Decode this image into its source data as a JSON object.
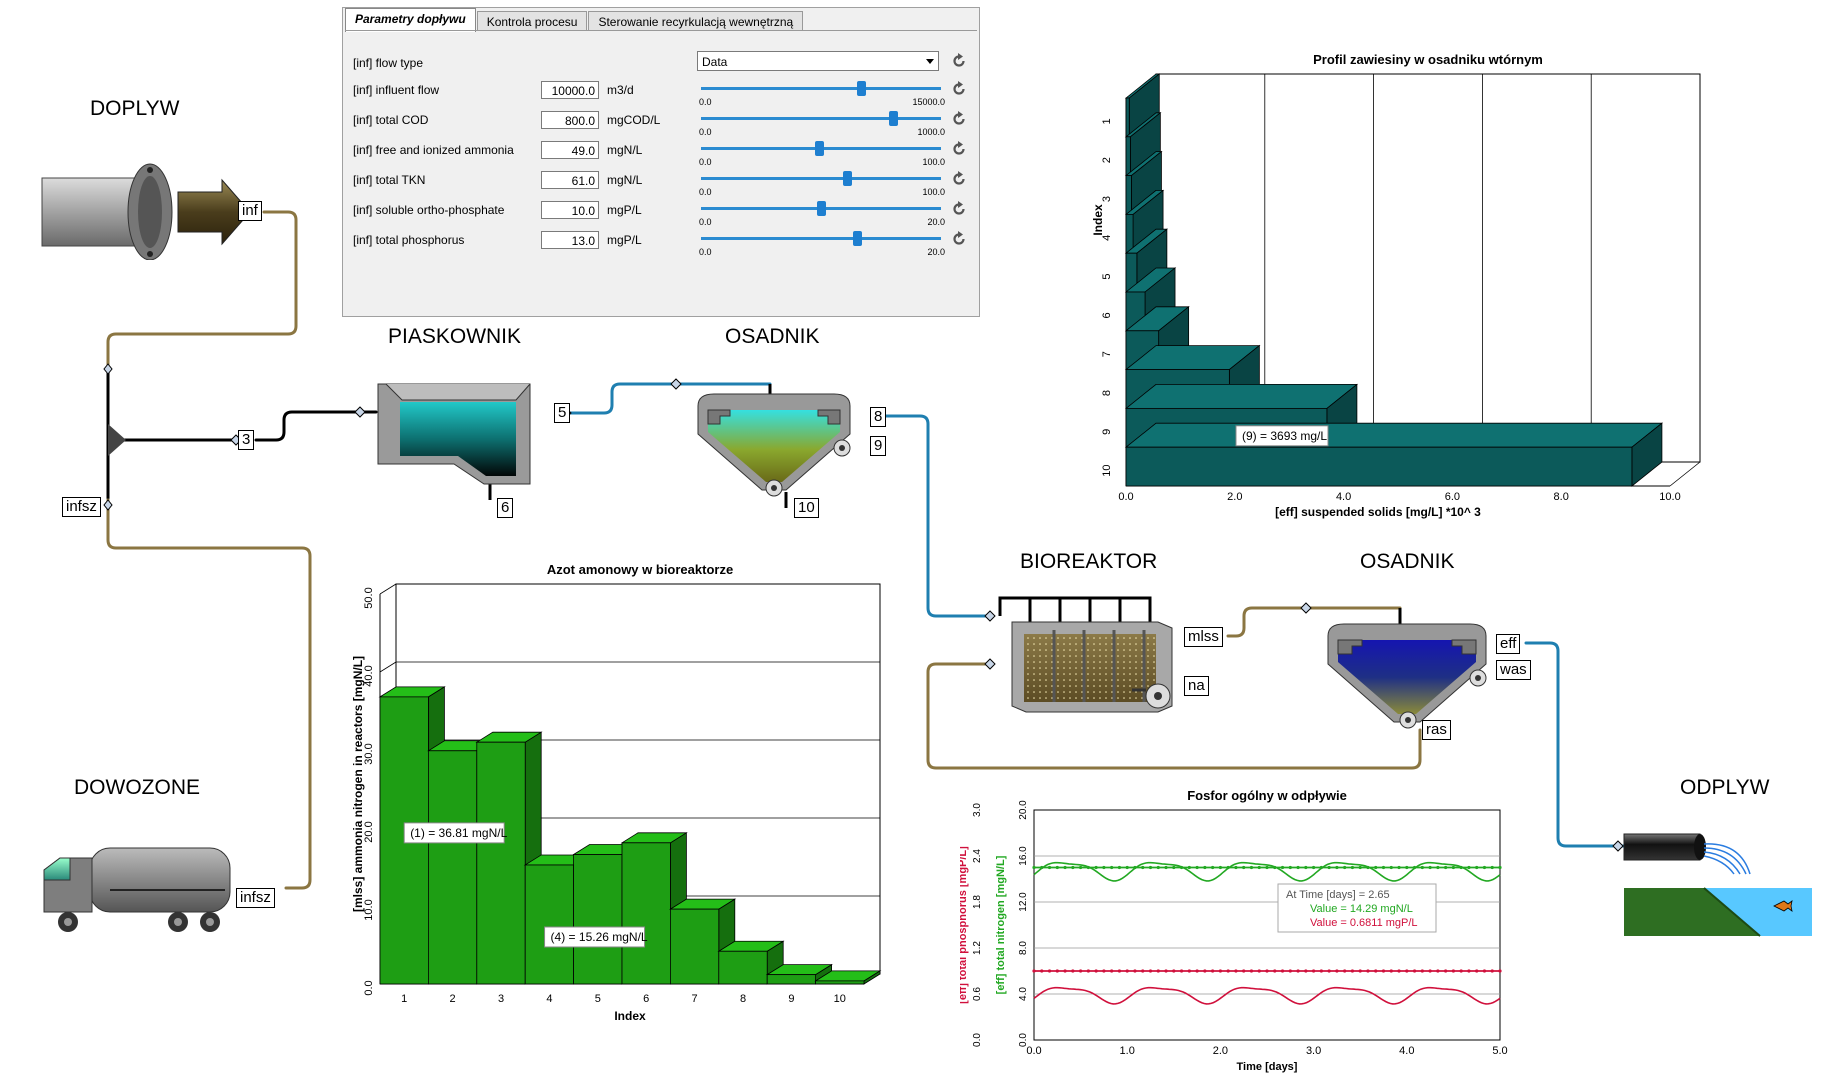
{
  "units": {
    "doplyw": "DOPLYW",
    "piaskownik": "PIASKOWNIK",
    "osadnik1": "OSADNIK",
    "bioreaktor": "BIOREAKTOR",
    "osadnik2": "OSADNIK",
    "dowozone": "DOWOZONE",
    "odplyw": "ODPLYW"
  },
  "ports": {
    "inf": "inf",
    "infsz_split": "infsz",
    "infsz_truck": "infsz",
    "p3": "3",
    "p5": "5",
    "p6": "6",
    "p8": "8",
    "p9": "9",
    "p10": "10",
    "mlss": "mlss",
    "na": "na",
    "eff": "eff",
    "was": "was",
    "ras": "ras"
  },
  "panel": {
    "tabs": [
      "Parametry dopływu",
      "Kontrola procesu",
      "Sterowanie recyrkulacją wewnętrzną"
    ],
    "flow_type_label": "[inf] flow type",
    "flow_type_value": "Data",
    "rows": [
      {
        "label": "[inf] influent flow",
        "value": "10000.0",
        "unit": "m3/d",
        "min": "0.0",
        "max": "15000.0",
        "level": 0.667
      },
      {
        "label": "[inf] total COD",
        "value": "800.0",
        "unit": "mgCOD/L",
        "min": "0.0",
        "max": "1000.0",
        "level": 0.8
      },
      {
        "label": "[inf] free and ionized ammonia",
        "value": "49.0",
        "unit": "mgN/L",
        "min": "0.0",
        "max": "100.0",
        "level": 0.49
      },
      {
        "label": "[inf] total TKN",
        "value": "61.0",
        "unit": "mgN/L",
        "min": "0.0",
        "max": "100.0",
        "level": 0.61
      },
      {
        "label": "[inf] soluble ortho-phosphate",
        "value": "10.0",
        "unit": "mgP/L",
        "min": "0.0",
        "max": "20.0",
        "level": 0.5
      },
      {
        "label": "[inf] total phosphorus",
        "value": "13.0",
        "unit": "mgP/L",
        "min": "0.0",
        "max": "20.0",
        "level": 0.65
      }
    ]
  },
  "chart_data": [
    {
      "type": "bar",
      "title": "Azot amonowy w bioreaktorze",
      "xlabel": "Index",
      "ylabel": "[mlss] ammonia nitrogen in reactors [mgN/L]",
      "categories": [
        "1",
        "2",
        "3",
        "4",
        "5",
        "6",
        "7",
        "8",
        "9",
        "10"
      ],
      "values": [
        36.81,
        29.9,
        31.0,
        15.26,
        16.6,
        18.1,
        9.6,
        4.2,
        1.2,
        0.4
      ],
      "ylim": [
        0,
        50
      ],
      "yticks": [
        "0.0",
        "10.0",
        "20.0",
        "30.0",
        "40.0",
        "50.0"
      ],
      "annotations": [
        "(1) = 36.81 mgN/L",
        "(4) = 15.26 mgN/L"
      ],
      "color": "#1e9e14"
    },
    {
      "type": "bar",
      "orientation": "horizontal",
      "title": "Profil zawiesiny w osadniku wtórnym",
      "xlabel": "[eff] suspended solids [mg/L] *10^ 3",
      "ylabel": "Index",
      "categories": [
        "1",
        "2",
        "3",
        "4",
        "5",
        "6",
        "7",
        "8",
        "9",
        "10"
      ],
      "values": [
        0.06,
        0.08,
        0.1,
        0.13,
        0.2,
        0.35,
        0.6,
        1.9,
        3.693,
        9.3
      ],
      "xlim": [
        0,
        10
      ],
      "xticks": [
        "0.0",
        "2.0",
        "4.0",
        "6.0",
        "8.0",
        "10.0"
      ],
      "annotation": "(9) = 3693 mg/L",
      "color": "#0c5a5a"
    },
    {
      "type": "line",
      "title": "Fosfor ogólny w odpływie",
      "xlabel": "Time [days]",
      "ylabel_left": "[eff] total phosphorus [mgP/L]",
      "ylabel_right": "[eff] total nitrogen [mgN/L]",
      "xlim": [
        0,
        5
      ],
      "xticks": [
        "0.0",
        "1.0",
        "2.0",
        "3.0",
        "4.0",
        "5.0"
      ],
      "yticks_p": [
        "0.0",
        "0.6",
        "1.2",
        "1.8",
        "2.4",
        "3.0"
      ],
      "yticks_n": [
        "0.0",
        "4.0",
        "8.0",
        "12.0",
        "16.0",
        "20.0"
      ],
      "series": [
        {
          "name": "[eff] total nitrogen",
          "axis": "n",
          "color": "#22a822",
          "mean": 14.8,
          "amp": 0.75,
          "ylim": [
            0,
            20
          ],
          "limit": 15.0
        },
        {
          "name": "[eff] total phosphorus",
          "axis": "p",
          "color": "#d0103c",
          "mean": 0.6,
          "amp": 0.1,
          "ylim": [
            0,
            3
          ],
          "limit": 0.9
        }
      ],
      "tooltip": {
        "time": "At Time [days] = 2.65",
        "n": "Value = 14.29 mgN/L",
        "p": "Value = 0.6811 mgP/L"
      }
    }
  ]
}
